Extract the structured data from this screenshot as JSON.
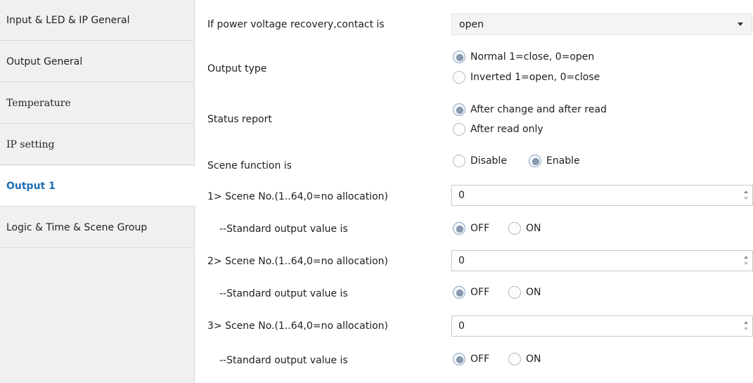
{
  "sidebar": {
    "items": [
      {
        "label": "Input & LED & IP General"
      },
      {
        "label": "Output General"
      },
      {
        "label": "Temperature"
      },
      {
        "label": "IP setting"
      },
      {
        "label": "Output 1",
        "active": true
      },
      {
        "label": "Logic & Time & Scene Group"
      }
    ]
  },
  "main": {
    "power_recovery": {
      "label": "If power voltage recovery,contact is",
      "value": "open"
    },
    "output_type": {
      "label": "Output type",
      "options": [
        "Normal 1=close, 0=open",
        "Inverted 1=open, 0=close"
      ],
      "selected": 0
    },
    "status_report": {
      "label": "Status report",
      "options": [
        "After change and after read",
        "After read only"
      ],
      "selected": 0
    },
    "scene_function": {
      "label": "Scene function is",
      "options": [
        "Disable",
        "Enable"
      ],
      "selected": 1
    },
    "scenes": [
      {
        "label": "1> Scene No.(1..64,0=no allocation)",
        "value": "0",
        "output_label": "--Standard output value is",
        "options": [
          "OFF",
          "ON"
        ],
        "selected": 0
      },
      {
        "label": "2> Scene No.(1..64,0=no allocation)",
        "value": "0",
        "output_label": "--Standard output value is",
        "options": [
          "OFF",
          "ON"
        ],
        "selected": 0
      },
      {
        "label": "3> Scene No.(1..64,0=no allocation)",
        "value": "0",
        "output_label": "--Standard output value is",
        "options": [
          "OFF",
          "ON"
        ],
        "selected": 0
      }
    ]
  },
  "colors": {
    "sidebar_bg": "#f0f0f0",
    "active_text": "#1f6fb4",
    "radio_dot": "#8a9bb2"
  },
  "icons": {
    "dropdown": "caret-down-icon",
    "spinner": "spinner-arrows-icon",
    "radio": "radio-button-icon"
  }
}
